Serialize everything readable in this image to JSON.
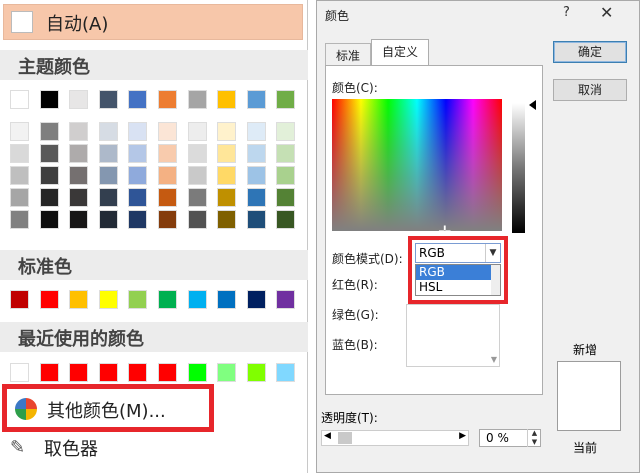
{
  "menu": {
    "auto_label": "自动(A)",
    "theme_heading": "主题颜色",
    "standard_heading": "标准色",
    "recent_heading": "最近使用的颜色",
    "more_colors_label": "其他颜色(M)...",
    "eyedropper_label": "取色器",
    "theme_top": [
      "#ffffff",
      "#000000",
      "#e7e6e6",
      "#44546a",
      "#4472c4",
      "#ed7d31",
      "#a5a5a5",
      "#ffc000",
      "#5b9bd5",
      "#70ad47"
    ],
    "theme_shades": [
      [
        "#f2f2f2",
        "#d9d9d9",
        "#bfbfbf",
        "#a6a6a6",
        "#808080"
      ],
      [
        "#7f7f7f",
        "#595959",
        "#3f3f3f",
        "#262626",
        "#0d0d0d"
      ],
      [
        "#d0cece",
        "#aeabab",
        "#757070",
        "#3a3838",
        "#171616"
      ],
      [
        "#d6dce4",
        "#adb9ca",
        "#8497b0",
        "#333f4f",
        "#222a35"
      ],
      [
        "#d9e2f3",
        "#b4c7e7",
        "#8faadc",
        "#2f5597",
        "#1f3864"
      ],
      [
        "#fbe5d6",
        "#f8cbad",
        "#f4b183",
        "#c55a11",
        "#843c0c"
      ],
      [
        "#ededed",
        "#dbdbdb",
        "#c9c9c9",
        "#7b7b7b",
        "#525252"
      ],
      [
        "#fff2cc",
        "#ffe699",
        "#ffd966",
        "#bf9000",
        "#7f6000"
      ],
      [
        "#deebf7",
        "#bdd7ee",
        "#9dc3e6",
        "#2e75b6",
        "#1f4e79"
      ],
      [
        "#e2f0d9",
        "#c5e0b4",
        "#a9d18e",
        "#548235",
        "#385723"
      ]
    ],
    "standard": [
      "#c00000",
      "#ff0000",
      "#ffc000",
      "#ffff00",
      "#92d050",
      "#00b050",
      "#00b0f0",
      "#0070c0",
      "#002060",
      "#7030a0"
    ],
    "recent": [
      "#ffffff",
      "#ff0000",
      "#ff0000",
      "#ff0000",
      "#ff0000",
      "#ff0000",
      "#00ff00",
      "#80ff80",
      "#80ff00",
      "#80d8ff"
    ]
  },
  "dialog": {
    "title": "颜色",
    "help": "?",
    "close": "✕",
    "tabs": [
      "标准",
      "自定义"
    ],
    "color_label": "颜色(C):",
    "mode_label": "颜色模式(D):",
    "mode_value": "RGB",
    "mode_options": [
      "RGB",
      "HSL"
    ],
    "red_label": "红色(R):",
    "green_label": "绿色(G):",
    "blue_label": "蓝色(B):",
    "ok": "确定",
    "cancel": "取消",
    "new_label": "新增",
    "current_label": "当前",
    "transparency_label": "透明度(T):",
    "transparency_value": "0 %"
  }
}
